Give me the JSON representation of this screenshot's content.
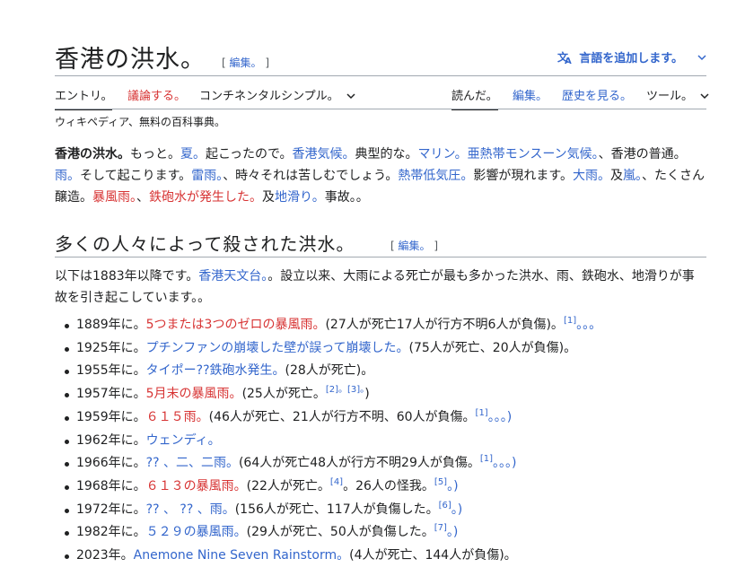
{
  "title": "香港の洪水。",
  "title_edit": {
    "open": "[ ",
    "label": "編集。",
    "close": " ]"
  },
  "lang_button": {
    "label": "言語を追加します。",
    "chevron": "⌄"
  },
  "tabs": {
    "entry": "エントリ。",
    "discuss": "議論する。",
    "variant": "コンチネンタルシンプル。",
    "read": "読んだ。",
    "edit": "編集。",
    "history": "歴史を見る。",
    "tools": "ツール。"
  },
  "tagline": "ウィキペディア、無料の百科事典。",
  "intro": {
    "s1_bold": "香港の洪水。",
    "s1_a": "もっと。",
    "s1_link_summer": "夏。",
    "s1_b": "起こったので。",
    "s1_link_climate": "香港気候。",
    "s1_c": "典型的な。",
    "s1_link_marin": "マリン。",
    "s1_link_monsoon": "亜熱帯モンスーン気候。",
    "s1_d": "、香港の普通。",
    "s1_link_rain": "雨。",
    "s1_e": "そして起こります。",
    "s1_link_thunder": "雷雨。",
    "s1_f": "、時々それは苦しむでしょう。",
    "s1_link_cyclone": "熱帯低気圧。",
    "s1_g": "影響が現れます。",
    "s1_link_heavy": "大雨。",
    "s1_h": "及",
    "s1_link_storm": "嵐。",
    "s1_i": "、たくさん醸造。",
    "s1_link_rainstorm": "暴風雨。",
    "s1_j": "、",
    "s1_link_flash": "鉄砲水が発生した。",
    "s1_k": "及",
    "s1_link_landslide": "地滑り。",
    "s1_l": "事故。。"
  },
  "section": {
    "heading": "多くの人々によって殺された洪水。",
    "edit": {
      "open": "[ ",
      "label": "編集。",
      "close": " ]"
    }
  },
  "section_intro": {
    "a": "以下は1883年以降です。",
    "link_obs": "香港天文台。",
    "b": "。設立以来、大雨による死亡が最も多かった洪水、雨、鉄砲水、地滑りが事故を引き起こしています。。"
  },
  "events": [
    {
      "year": "1889年に。",
      "link": "5つまたは3つのゼロの暴風雨。",
      "red": true,
      "desc": "(27人が死亡17人が行方不明6人が負傷)。",
      "refs": "[1]",
      "tail": "。。。"
    },
    {
      "year": "1925年に。",
      "link": "プチンファンの崩壊した壁が誤って崩壊した。",
      "red": false,
      "desc": "(75人が死亡、20人が負傷)。",
      "refs": "",
      "tail": ""
    },
    {
      "year": "1955年に。",
      "link": "タイポー??鉄砲水発生。",
      "red": false,
      "desc": "(28人が死亡)。",
      "refs": "",
      "tail": ""
    },
    {
      "year": "1957年に。",
      "link": "5月末の暴風雨。",
      "red": true,
      "desc": "(25人が死亡。",
      "refs": "[2]。[3]。",
      "tail": ")"
    },
    {
      "year": "1959年に。",
      "link": "６１５雨。",
      "red": true,
      "desc": "(46人が死亡、21人が行方不明、60人が負傷。",
      "refs": "[1]",
      "tail": "。。。)"
    },
    {
      "year": "1962年に。",
      "link": "ウェンディ。",
      "red": false,
      "desc": "",
      "refs": "",
      "tail": ""
    },
    {
      "year": "1966年に。",
      "link": "?? 、二、二雨。",
      "red": false,
      "desc": "(64人が死亡48人が行方不明29人が負傷。",
      "refs": "[1]",
      "tail": "。。。)"
    },
    {
      "year": "1968年に。",
      "link": "６１３の暴風雨。",
      "red": true,
      "desc": "(22人が死亡。",
      "refs": "[4]",
      "tail2": "。26人の怪我。",
      "refs2": "[5]",
      "tail": "。)"
    },
    {
      "year": "1972年に。",
      "link": "?? 、 ?? 、雨。",
      "red": false,
      "desc": "(156人が死亡、117人が負傷した。",
      "refs": "[6]",
      "tail": "。)"
    },
    {
      "year": "1982年に。",
      "link": "５２９の暴風雨。",
      "red": false,
      "desc": "(29人が死亡、50人が負傷した。",
      "refs": "[7]",
      "tail": "。)"
    },
    {
      "year": "2023年。",
      "link": "Anemone Nine Seven Rainstorm。",
      "red": false,
      "desc": "(4人が死亡、144人が負傷)。",
      "refs": "",
      "tail": ""
    }
  ],
  "colors": {
    "link": "#3366cc",
    "redlink": "#d73333",
    "text": "#202122",
    "rule": "#a2a9b1"
  }
}
